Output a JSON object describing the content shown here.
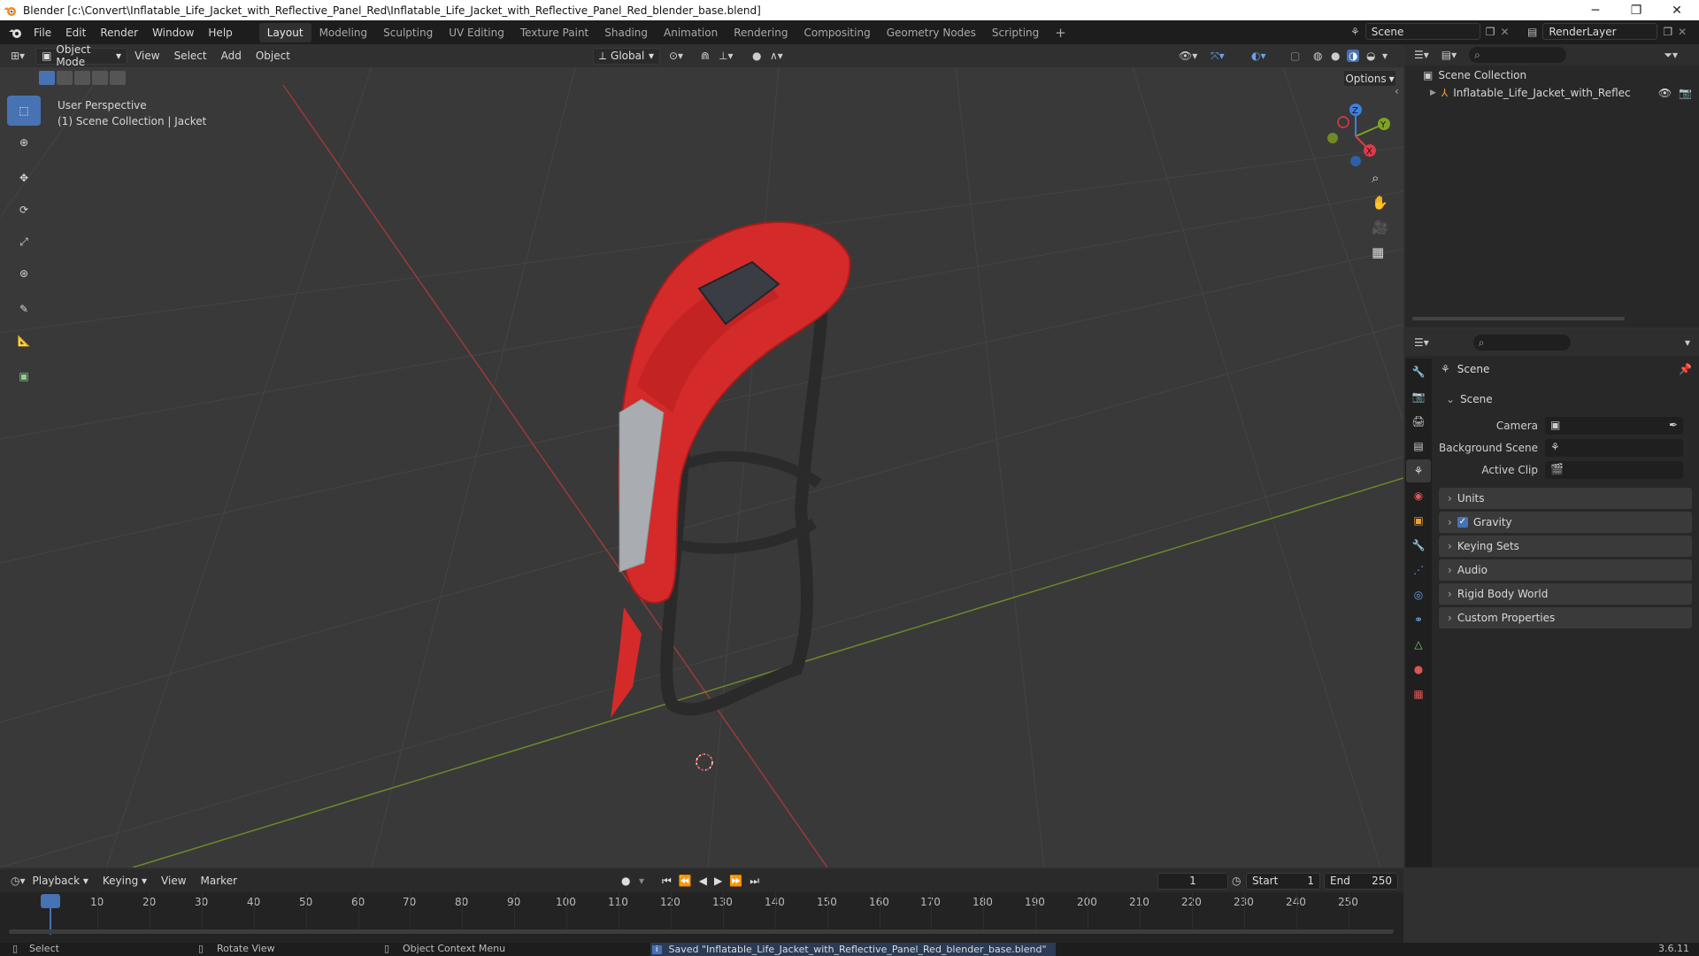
{
  "window": {
    "title": "Blender [c:\\Convert\\Inflatable_Life_Jacket_with_Reflective_Panel_Red\\Inflatable_Life_Jacket_with_Reflective_Panel_Red_blender_base.blend]",
    "minimize": "─",
    "maximize": "❐",
    "close": "✕"
  },
  "menubar": {
    "items": [
      "File",
      "Edit",
      "Render",
      "Window",
      "Help"
    ]
  },
  "workspaces": {
    "tabs": [
      "Layout",
      "Modeling",
      "Sculpting",
      "UV Editing",
      "Texture Paint",
      "Shading",
      "Animation",
      "Rendering",
      "Compositing",
      "Geometry Nodes",
      "Scripting"
    ],
    "active": "Layout",
    "add": "+"
  },
  "scene_selector": {
    "value": "Scene"
  },
  "view_layer_selector": {
    "value": "RenderLayer"
  },
  "viewport_header": {
    "mode": "Object Mode",
    "menus": [
      "View",
      "Select",
      "Add",
      "Object"
    ],
    "orientation": "Global",
    "options_label": "Options"
  },
  "viewport": {
    "overlay_line1": "User Perspective",
    "overlay_line2": "(1) Scene Collection | Jacket",
    "gizmo_axes": {
      "x": "X",
      "y": "Y",
      "z": "Z"
    }
  },
  "outliner": {
    "root": "Scene Collection",
    "items": [
      {
        "label": "Inflatable_Life_Jacket_with_Reflective_F"
      }
    ]
  },
  "properties": {
    "header": "Scene",
    "section": "Scene",
    "fields": {
      "camera_label": "Camera",
      "background_scene_label": "Background Scene",
      "active_clip_label": "Active Clip"
    },
    "panels": [
      "Units",
      "Gravity",
      "Keying Sets",
      "Audio",
      "Rigid Body World",
      "Custom Properties"
    ],
    "gravity_checked": true
  },
  "timeline": {
    "menus": [
      "Playback",
      "Keying",
      "View",
      "Marker"
    ],
    "current_frame": "1",
    "start_label": "Start",
    "start_value": "1",
    "end_label": "End",
    "end_value": "250",
    "ticks": [
      "1",
      "10",
      "20",
      "30",
      "40",
      "50",
      "60",
      "70",
      "80",
      "90",
      "100",
      "110",
      "120",
      "130",
      "140",
      "150",
      "160",
      "170",
      "180",
      "190",
      "200",
      "210",
      "220",
      "230",
      "240",
      "250"
    ]
  },
  "statusbar": {
    "select": "Select",
    "rotate": "Rotate View",
    "context": "Object Context Menu",
    "message": "Saved \"Inflatable_Life_Jacket_with_Reflective_Panel_Red_blender_base.blend\"",
    "version": "3.6.11"
  },
  "colors": {
    "accent": "#4772b3",
    "x_axis": "#e0394b",
    "y_axis": "#7fa323",
    "z_axis": "#3f7fe0",
    "jacket_red": "#d42a2a"
  }
}
